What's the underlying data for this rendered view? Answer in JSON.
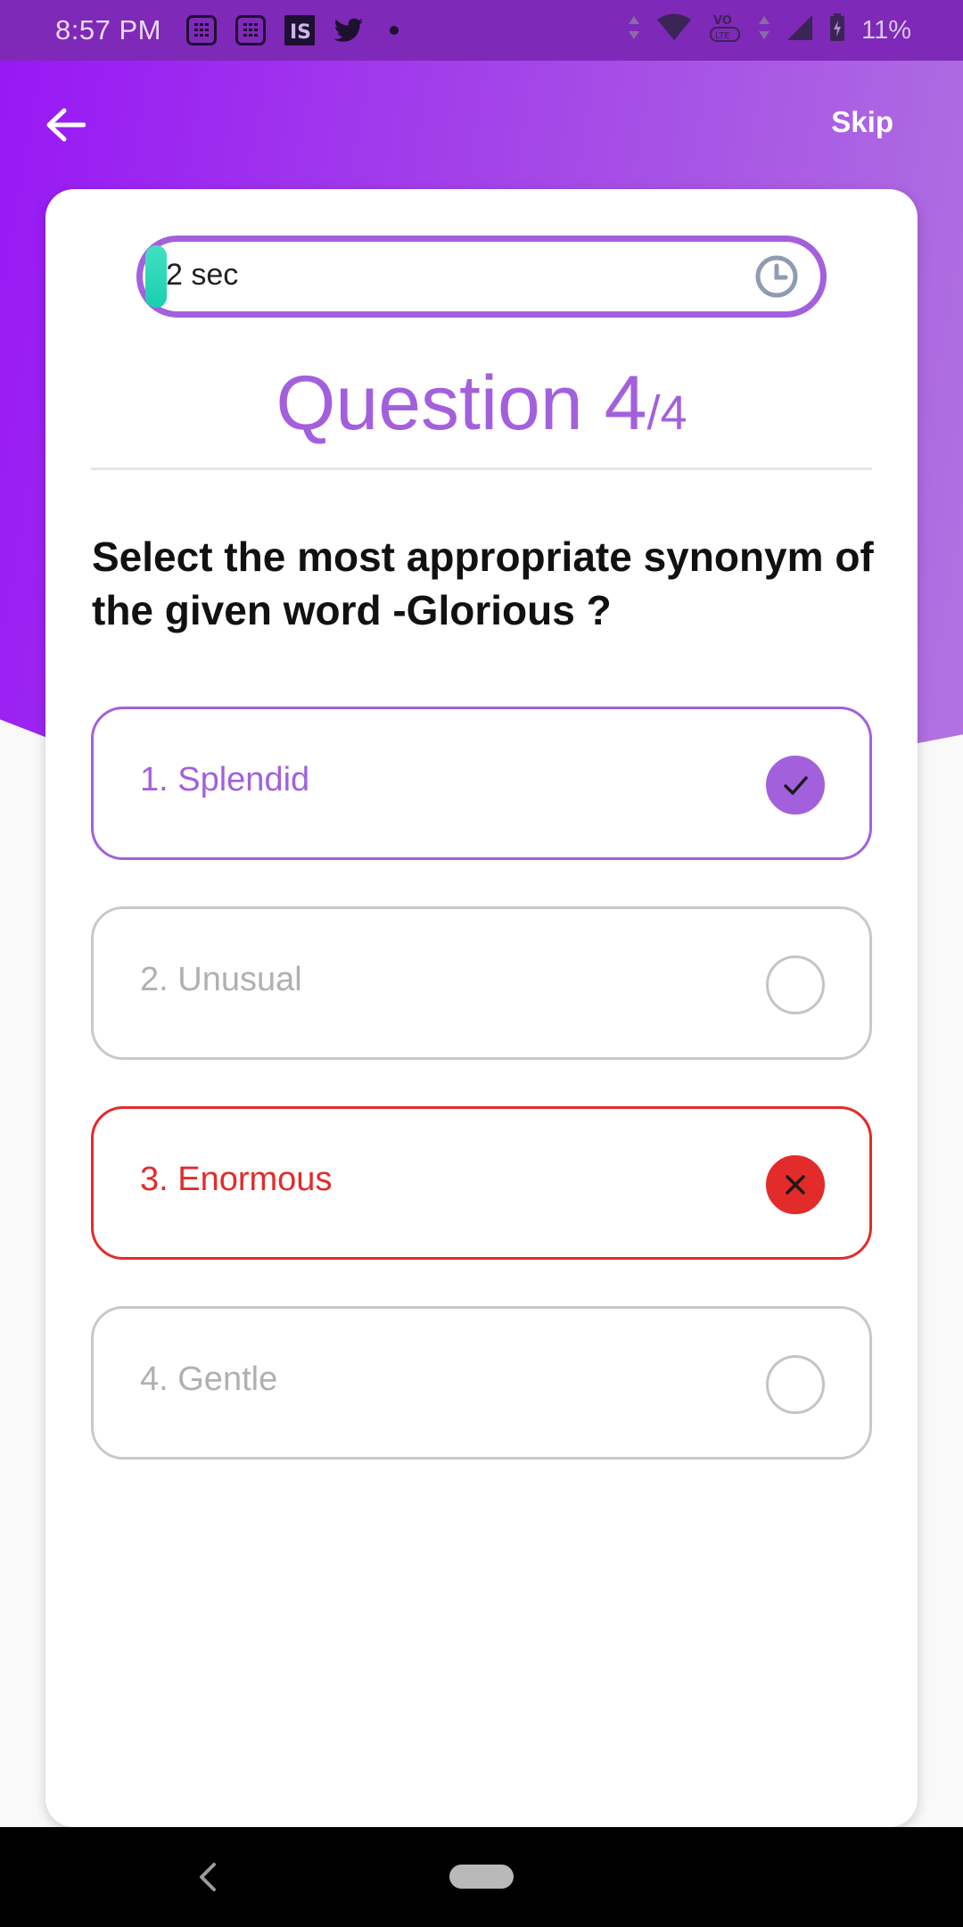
{
  "status_bar": {
    "time": "8:57 PM",
    "notification_icons": [
      "calculator-icon",
      "calculator-icon",
      "is-app-icon",
      "twitter-icon",
      "dot-icon"
    ],
    "battery_text": "11%",
    "network_label": "VO LTE"
  },
  "app_bar": {
    "back_icon": "arrow-left-icon",
    "skip_label": "Skip"
  },
  "timer": {
    "text": "2 sec",
    "progress_fraction": 0.03,
    "icon": "clock-icon"
  },
  "question": {
    "heading": "Question 4",
    "total": "/4",
    "text": "Select the most appropriate synonym of the given word -Glorious ?"
  },
  "options": [
    {
      "label": "1. Splendid",
      "state": "correct",
      "icon": "check-icon"
    },
    {
      "label": "2. Unusual",
      "state": "unselected",
      "icon": "empty-circle-icon"
    },
    {
      "label": "3. Enormous",
      "state": "wrong",
      "icon": "close-icon"
    },
    {
      "label": "4. Gentle",
      "state": "unselected",
      "icon": "empty-circle-icon"
    }
  ],
  "colors": {
    "accent": "#a360dd",
    "header_start": "#9817f5",
    "wrong": "#e32b2b",
    "timer_fill": "#19cfb0"
  }
}
